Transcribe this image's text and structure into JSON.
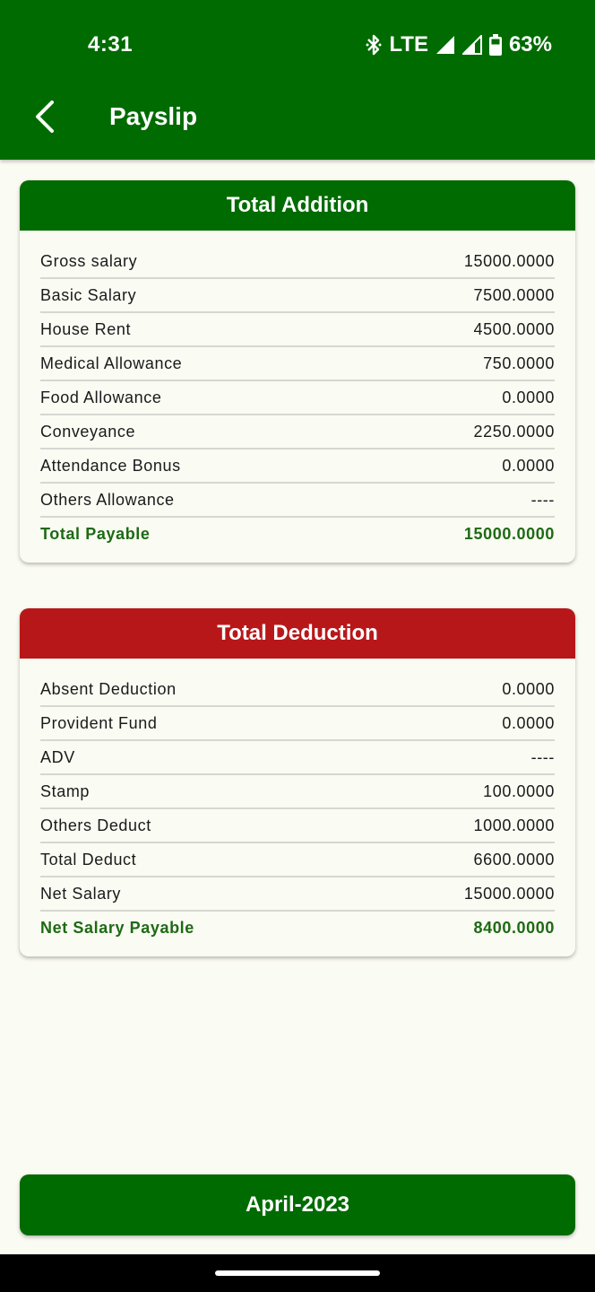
{
  "status_bar": {
    "time": "4:31",
    "network": "LTE",
    "battery": "63%"
  },
  "app_bar": {
    "title": "Payslip",
    "back_icon": "chevron-left-icon"
  },
  "addition": {
    "header": "Total Addition",
    "header_color": "#006b00",
    "rows": [
      {
        "label": "Gross salary",
        "value": "15000.0000"
      },
      {
        "label": "Basic Salary",
        "value": "7500.0000"
      },
      {
        "label": "House Rent",
        "value": "4500.0000"
      },
      {
        "label": "Medical Allowance",
        "value": "750.0000"
      },
      {
        "label": "Food Allowance",
        "value": "0.0000"
      },
      {
        "label": "Conveyance",
        "value": "2250.0000"
      },
      {
        "label": "Attendance Bonus",
        "value": "0.0000"
      },
      {
        "label": "Others Allowance",
        "value": "----"
      }
    ],
    "total": {
      "label": "Total Payable",
      "value": "15000.0000"
    }
  },
  "deduction": {
    "header": "Total Deduction",
    "header_color": "#b8171a",
    "rows": [
      {
        "label": "Absent Deduction",
        "value": "0.0000"
      },
      {
        "label": "Provident Fund",
        "value": "0.0000"
      },
      {
        "label": "ADV",
        "value": "----"
      },
      {
        "label": "Stamp",
        "value": "100.0000"
      },
      {
        "label": "Others Deduct",
        "value": "1000.0000"
      },
      {
        "label": "Total Deduct",
        "value": "6600.0000"
      },
      {
        "label": "Net Salary",
        "value": "15000.0000"
      }
    ],
    "total": {
      "label": "Net Salary Payable",
      "value": "8400.0000"
    }
  },
  "month_button": {
    "label": "April-2023"
  },
  "colors": {
    "brand_green": "#006b00",
    "deduction_red": "#b8171a",
    "total_text": "#1e6a14",
    "background": "#fafbf3"
  }
}
